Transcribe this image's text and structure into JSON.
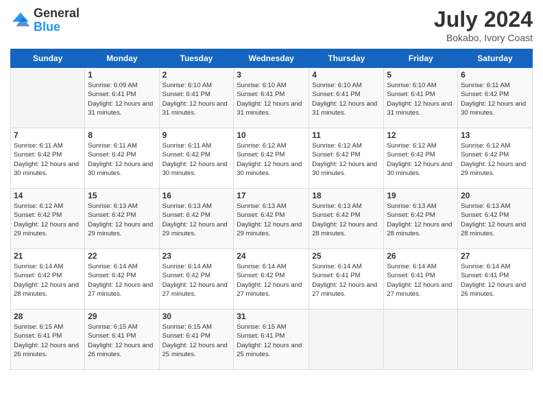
{
  "header": {
    "logo_general": "General",
    "logo_blue": "Blue",
    "month_year": "July 2024",
    "location": "Bokabo, Ivory Coast"
  },
  "weekdays": [
    "Sunday",
    "Monday",
    "Tuesday",
    "Wednesday",
    "Thursday",
    "Friday",
    "Saturday"
  ],
  "weeks": [
    [
      {
        "day": "",
        "sunrise": "",
        "sunset": "",
        "daylight": ""
      },
      {
        "day": "1",
        "sunrise": "Sunrise: 6:09 AM",
        "sunset": "Sunset: 6:41 PM",
        "daylight": "Daylight: 12 hours and 31 minutes."
      },
      {
        "day": "2",
        "sunrise": "Sunrise: 6:10 AM",
        "sunset": "Sunset: 6:41 PM",
        "daylight": "Daylight: 12 hours and 31 minutes."
      },
      {
        "day": "3",
        "sunrise": "Sunrise: 6:10 AM",
        "sunset": "Sunset: 6:41 PM",
        "daylight": "Daylight: 12 hours and 31 minutes."
      },
      {
        "day": "4",
        "sunrise": "Sunrise: 6:10 AM",
        "sunset": "Sunset: 6:41 PM",
        "daylight": "Daylight: 12 hours and 31 minutes."
      },
      {
        "day": "5",
        "sunrise": "Sunrise: 6:10 AM",
        "sunset": "Sunset: 6:41 PM",
        "daylight": "Daylight: 12 hours and 31 minutes."
      },
      {
        "day": "6",
        "sunrise": "Sunrise: 6:11 AM",
        "sunset": "Sunset: 6:42 PM",
        "daylight": "Daylight: 12 hours and 30 minutes."
      }
    ],
    [
      {
        "day": "7",
        "sunrise": "Sunrise: 6:11 AM",
        "sunset": "Sunset: 6:42 PM",
        "daylight": "Daylight: 12 hours and 30 minutes."
      },
      {
        "day": "8",
        "sunrise": "Sunrise: 6:11 AM",
        "sunset": "Sunset: 6:42 PM",
        "daylight": "Daylight: 12 hours and 30 minutes."
      },
      {
        "day": "9",
        "sunrise": "Sunrise: 6:11 AM",
        "sunset": "Sunset: 6:42 PM",
        "daylight": "Daylight: 12 hours and 30 minutes."
      },
      {
        "day": "10",
        "sunrise": "Sunrise: 6:12 AM",
        "sunset": "Sunset: 6:42 PM",
        "daylight": "Daylight: 12 hours and 30 minutes."
      },
      {
        "day": "11",
        "sunrise": "Sunrise: 6:12 AM",
        "sunset": "Sunset: 6:42 PM",
        "daylight": "Daylight: 12 hours and 30 minutes."
      },
      {
        "day": "12",
        "sunrise": "Sunrise: 6:12 AM",
        "sunset": "Sunset: 6:42 PM",
        "daylight": "Daylight: 12 hours and 30 minutes."
      },
      {
        "day": "13",
        "sunrise": "Sunrise: 6:12 AM",
        "sunset": "Sunset: 6:42 PM",
        "daylight": "Daylight: 12 hours and 29 minutes."
      }
    ],
    [
      {
        "day": "14",
        "sunrise": "Sunrise: 6:12 AM",
        "sunset": "Sunset: 6:42 PM",
        "daylight": "Daylight: 12 hours and 29 minutes."
      },
      {
        "day": "15",
        "sunrise": "Sunrise: 6:13 AM",
        "sunset": "Sunset: 6:42 PM",
        "daylight": "Daylight: 12 hours and 29 minutes."
      },
      {
        "day": "16",
        "sunrise": "Sunrise: 6:13 AM",
        "sunset": "Sunset: 6:42 PM",
        "daylight": "Daylight: 12 hours and 29 minutes."
      },
      {
        "day": "17",
        "sunrise": "Sunrise: 6:13 AM",
        "sunset": "Sunset: 6:42 PM",
        "daylight": "Daylight: 12 hours and 29 minutes."
      },
      {
        "day": "18",
        "sunrise": "Sunrise: 6:13 AM",
        "sunset": "Sunset: 6:42 PM",
        "daylight": "Daylight: 12 hours and 28 minutes."
      },
      {
        "day": "19",
        "sunrise": "Sunrise: 6:13 AM",
        "sunset": "Sunset: 6:42 PM",
        "daylight": "Daylight: 12 hours and 28 minutes."
      },
      {
        "day": "20",
        "sunrise": "Sunrise: 6:13 AM",
        "sunset": "Sunset: 6:42 PM",
        "daylight": "Daylight: 12 hours and 28 minutes."
      }
    ],
    [
      {
        "day": "21",
        "sunrise": "Sunrise: 6:14 AM",
        "sunset": "Sunset: 6:42 PM",
        "daylight": "Daylight: 12 hours and 28 minutes."
      },
      {
        "day": "22",
        "sunrise": "Sunrise: 6:14 AM",
        "sunset": "Sunset: 6:42 PM",
        "daylight": "Daylight: 12 hours and 27 minutes."
      },
      {
        "day": "23",
        "sunrise": "Sunrise: 6:14 AM",
        "sunset": "Sunset: 6:42 PM",
        "daylight": "Daylight: 12 hours and 27 minutes."
      },
      {
        "day": "24",
        "sunrise": "Sunrise: 6:14 AM",
        "sunset": "Sunset: 6:42 PM",
        "daylight": "Daylight: 12 hours and 27 minutes."
      },
      {
        "day": "25",
        "sunrise": "Sunrise: 6:14 AM",
        "sunset": "Sunset: 6:41 PM",
        "daylight": "Daylight: 12 hours and 27 minutes."
      },
      {
        "day": "26",
        "sunrise": "Sunrise: 6:14 AM",
        "sunset": "Sunset: 6:41 PM",
        "daylight": "Daylight: 12 hours and 27 minutes."
      },
      {
        "day": "27",
        "sunrise": "Sunrise: 6:14 AM",
        "sunset": "Sunset: 6:41 PM",
        "daylight": "Daylight: 12 hours and 26 minutes."
      }
    ],
    [
      {
        "day": "28",
        "sunrise": "Sunrise: 6:15 AM",
        "sunset": "Sunset: 6:41 PM",
        "daylight": "Daylight: 12 hours and 26 minutes."
      },
      {
        "day": "29",
        "sunrise": "Sunrise: 6:15 AM",
        "sunset": "Sunset: 6:41 PM",
        "daylight": "Daylight: 12 hours and 26 minutes."
      },
      {
        "day": "30",
        "sunrise": "Sunrise: 6:15 AM",
        "sunset": "Sunset: 6:41 PM",
        "daylight": "Daylight: 12 hours and 25 minutes."
      },
      {
        "day": "31",
        "sunrise": "Sunrise: 6:15 AM",
        "sunset": "Sunset: 6:41 PM",
        "daylight": "Daylight: 12 hours and 25 minutes."
      },
      {
        "day": "",
        "sunrise": "",
        "sunset": "",
        "daylight": ""
      },
      {
        "day": "",
        "sunrise": "",
        "sunset": "",
        "daylight": ""
      },
      {
        "day": "",
        "sunrise": "",
        "sunset": "",
        "daylight": ""
      }
    ]
  ]
}
